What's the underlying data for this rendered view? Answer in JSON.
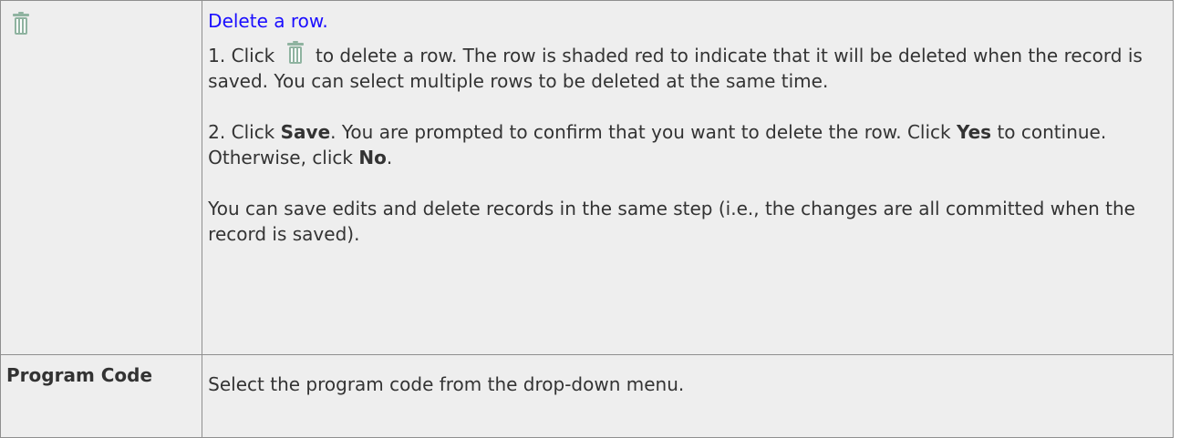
{
  "rows": [
    {
      "label_icon": "trash-icon",
      "title": "Delete a row.",
      "step1_prefix": "1. Click",
      "step1_icon": "trash-icon",
      "step1_suffix": "to delete a row. The row is shaded red to indicate that it will be deleted when the record is saved. You can select multiple rows to be deleted at the same time.",
      "step2_prefix": "2. Click",
      "step2_bold1": "Save",
      "step2_mid": ". You are prompted to confirm that you want to delete the row. Click",
      "step2_bold2": "Yes",
      "step2_mid2": "to continue. Otherwise, click",
      "step2_bold3": "No",
      "step2_end": ".",
      "note": "You can save edits and delete records in the same step (i.e., the changes are all committed when the record is saved)."
    },
    {
      "label": "Program Code",
      "description": "Select the program code from the drop-down menu."
    }
  ],
  "colors": {
    "cell_background": "#eeeeee",
    "border": "#8f8f8f",
    "link": "#1a0dff",
    "text": "#333333",
    "icon": "#8fb3a0"
  }
}
